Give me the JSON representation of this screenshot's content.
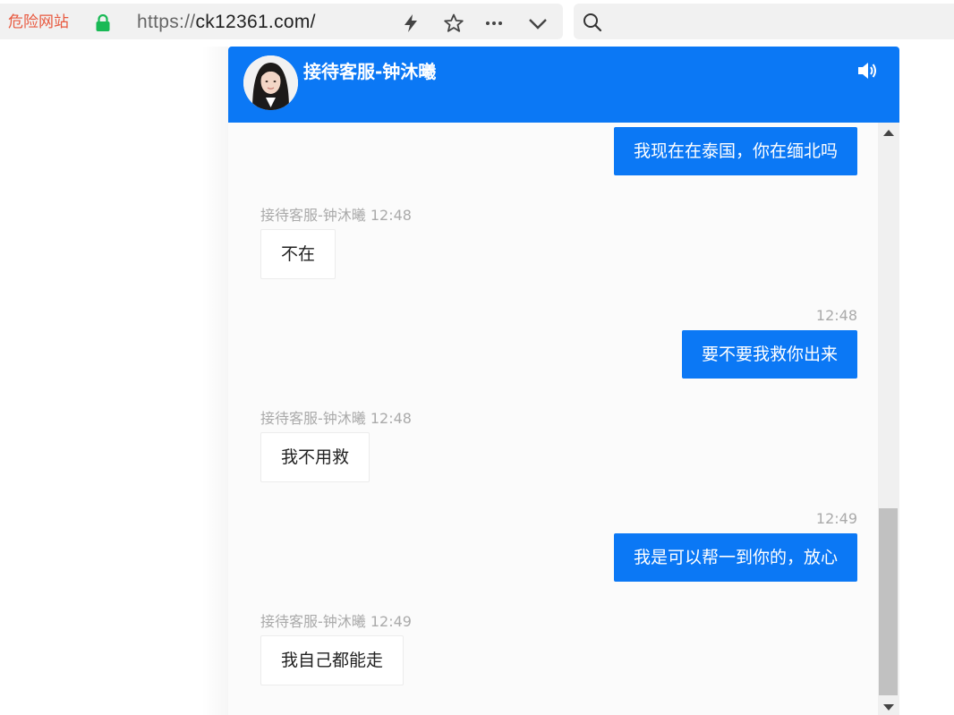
{
  "browser": {
    "danger_label": "危险网站",
    "url_scheme": "https://",
    "url_host": "ck12361.com/",
    "icons": [
      "lock-icon",
      "lightning-icon",
      "star-icon",
      "more-icon",
      "chevron-down-icon",
      "search-icon"
    ],
    "lock_color": "#19b955"
  },
  "chat": {
    "agent_name": "接待客服-钟沐曦",
    "header_color": "#0b78f5",
    "sound_icon": "speaker-icon",
    "messages": [
      {
        "from": "me",
        "text": "我现在在泰国，你在缅北吗"
      },
      {
        "from": "agent",
        "time": "接待客服-钟沐曦 12:48",
        "text": "不在"
      },
      {
        "from": "me",
        "time": "12:48",
        "text": "要不要我救你出来"
      },
      {
        "from": "agent",
        "time": "接待客服-钟沐曦 12:48",
        "text": "我不用救"
      },
      {
        "from": "me",
        "time": "12:49",
        "text": "我是可以帮一到你的，放心"
      },
      {
        "from": "agent",
        "time": "接待客服-钟沐曦 12:49",
        "text": "我自己都能走"
      }
    ]
  }
}
